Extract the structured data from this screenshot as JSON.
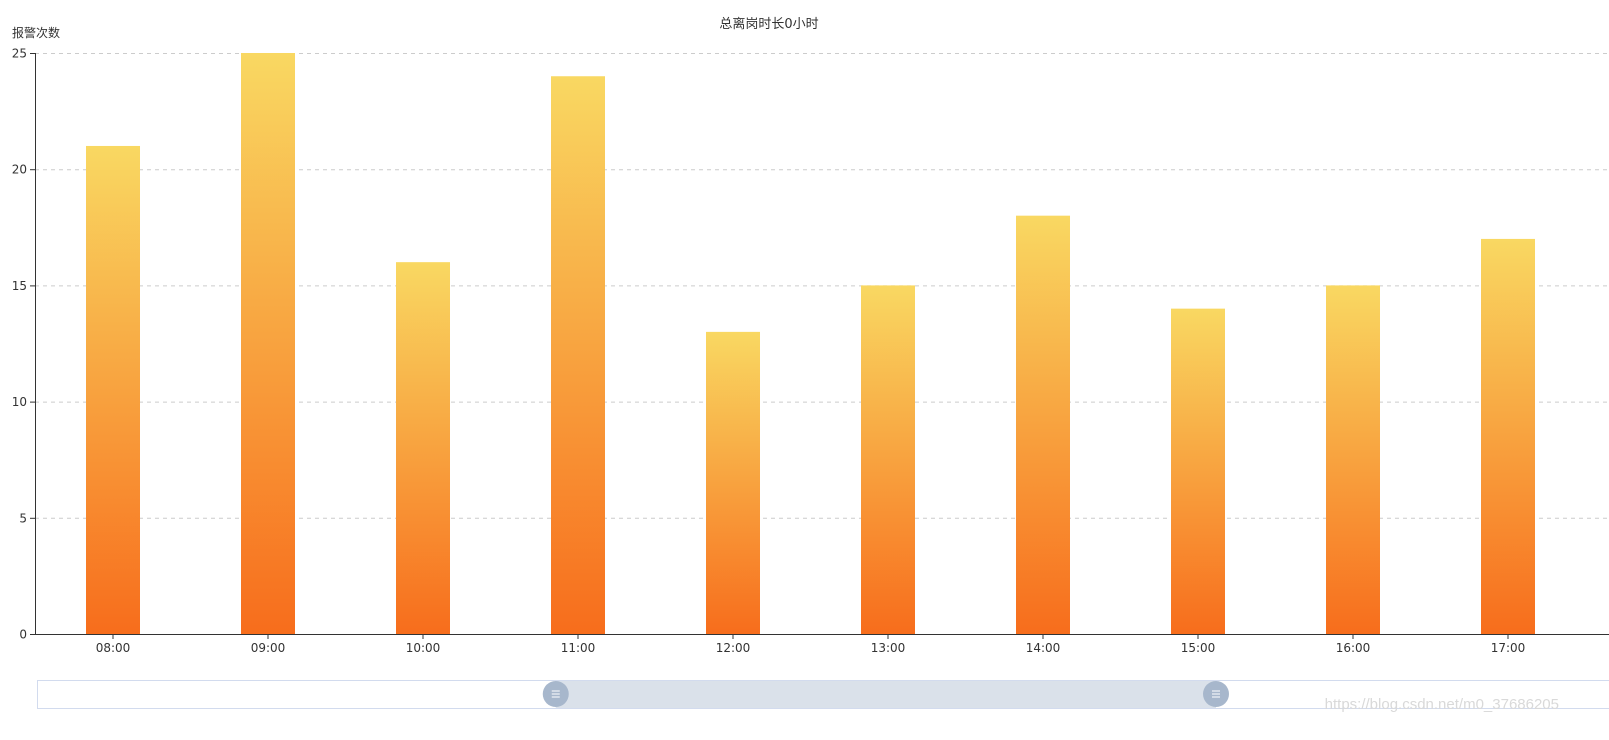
{
  "chart_data": {
    "type": "bar",
    "title": "总离岗时长0小时",
    "ylabel": "报警次数",
    "xlabel": "",
    "categories": [
      "08:00",
      "09:00",
      "10:00",
      "11:00",
      "12:00",
      "13:00",
      "14:00",
      "15:00",
      "16:00",
      "17:00"
    ],
    "values": [
      21,
      25,
      16,
      24,
      13,
      15,
      18,
      14,
      15,
      17
    ],
    "ylim": [
      0,
      25
    ],
    "yticks": [
      0,
      5,
      10,
      15,
      20,
      25
    ],
    "grid": "horizontal-dashed",
    "legend": "none",
    "colors": {
      "bar_top": "#f9d862",
      "bar_bottom": "#f76d1c",
      "axis": "#333333",
      "grid": "#cccccc",
      "slider_fill": "#dae1ea",
      "slider_border": "#d2dbee",
      "slider_handle": "#a7b7cc"
    }
  },
  "data_zoom": {
    "start_fraction": 0.33,
    "end_fraction": 0.75,
    "handle_icon": "grip-lines-icon"
  },
  "watermark": "https://blog.csdn.net/m0_37686205"
}
